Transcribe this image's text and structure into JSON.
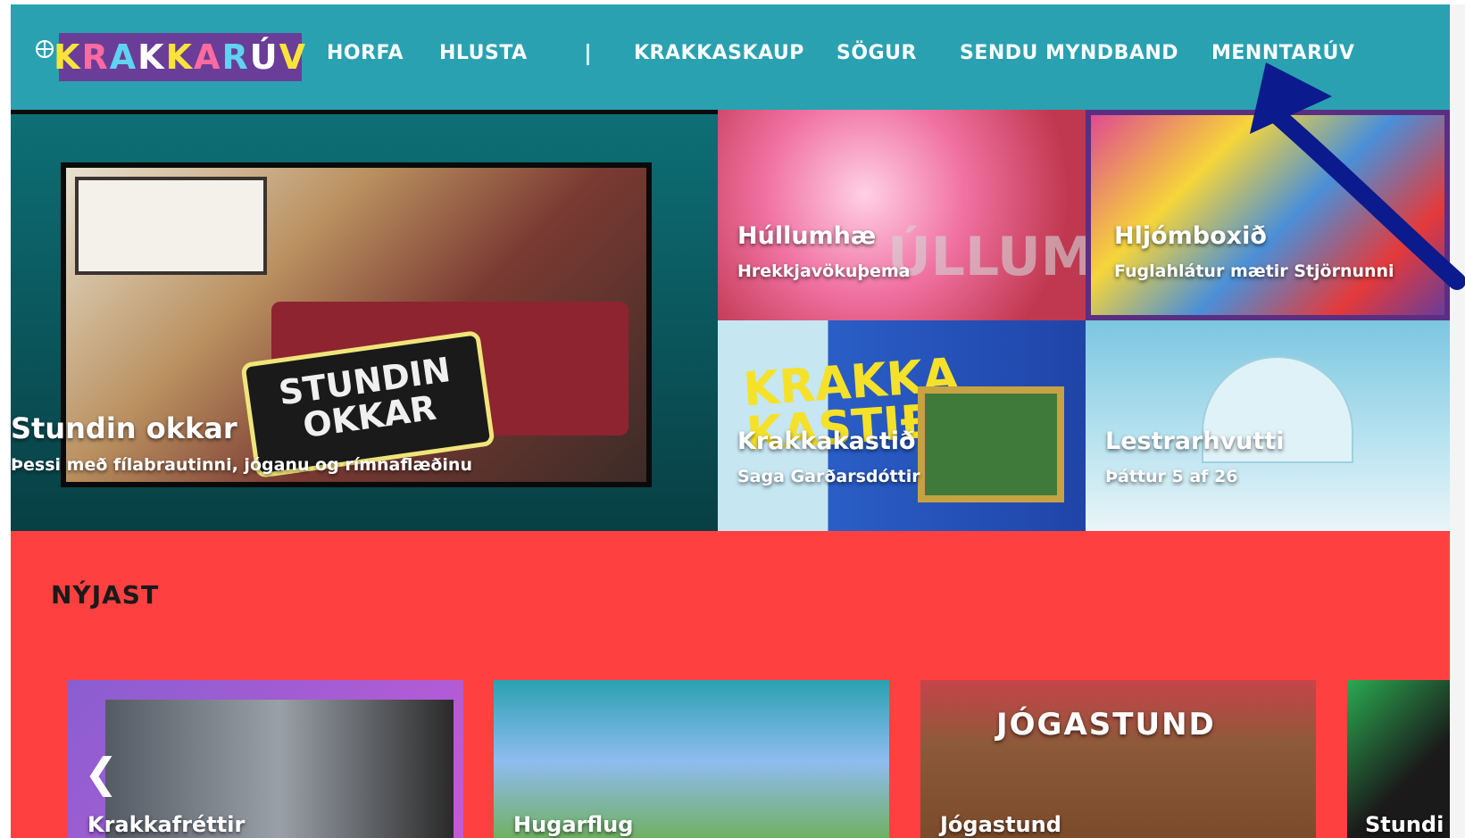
{
  "header": {
    "logo_text": "KRAKKARÚV",
    "nav": [
      "HORFA",
      "HLUSTA",
      "KRAKKASKAUP",
      "SÖGUR",
      "SENDU MYNDBAND",
      "MENNTARÚV"
    ],
    "colors": {
      "header_bg": "#2aa1b0",
      "logo_bg": "#6a3d98"
    }
  },
  "hero": {
    "title": "Stundin okkar",
    "subtitle": "Þessi með fílabrautinni, jóganu og rímnaflæðinu",
    "logo_text": "STUNDIN OKKAR"
  },
  "tiles": [
    {
      "title": "Húllumhæ",
      "subtitle": "Hrekkjavökuþema",
      "logo_text": "ÚLLUMHÆ"
    },
    {
      "title": "Hljómboxið",
      "subtitle": "Fuglahlátur mætir Stjörnunni"
    },
    {
      "title": "Krakkakastið",
      "subtitle": "Saga Garðarsdóttir",
      "logo_text": "KRAKKA KASTIÐ"
    },
    {
      "title": "Lestrarhvutti",
      "subtitle": "Þáttur 5 af 26"
    }
  ],
  "newest": {
    "heading": "NÝJAST",
    "prev_icon": "chevron-left-icon",
    "items": [
      {
        "title": "Krakkafréttir"
      },
      {
        "title": "Hugarflug"
      },
      {
        "title": "Jógastund",
        "logo_text": "JÓGASTUND"
      },
      {
        "title": "Stundi"
      }
    ]
  },
  "annotation": {
    "icon": "arrow-icon",
    "color": "#0b1a8c"
  },
  "colors": {
    "page_bg": "#ff4040"
  }
}
